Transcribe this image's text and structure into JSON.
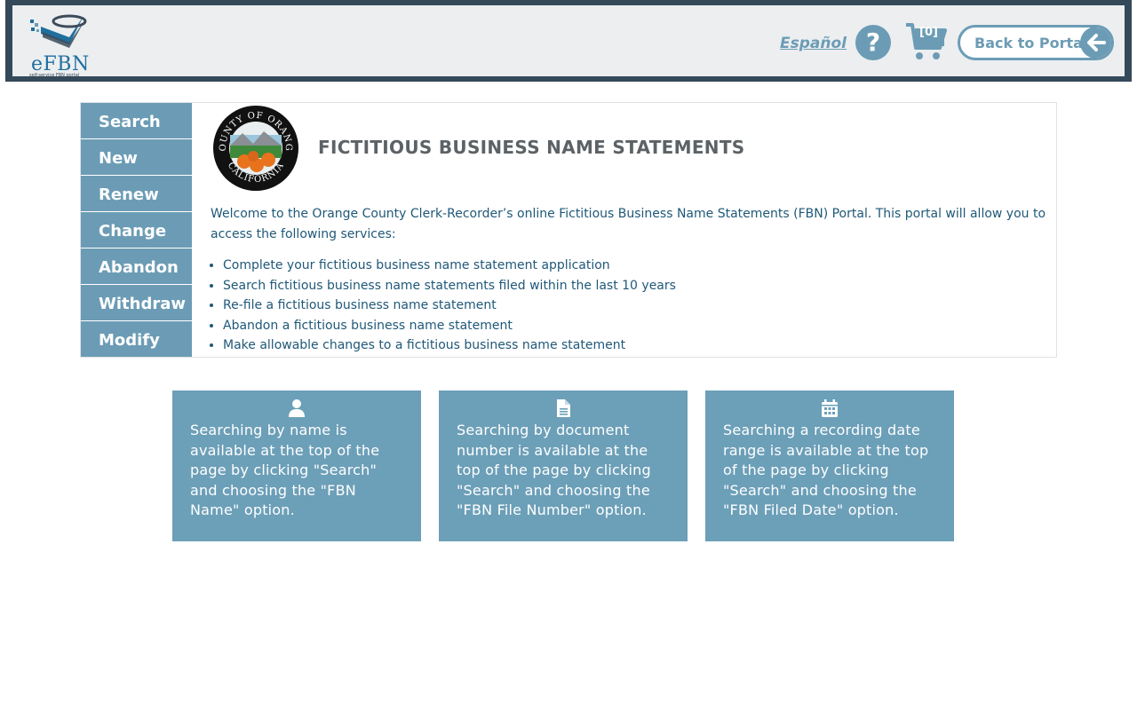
{
  "header": {
    "logo_text": "eFBN",
    "logo_subtext": "self-service FBN portal",
    "language_link": "Español",
    "help_label": "?",
    "cart_count": "[0]",
    "back_button": "Back to Portal"
  },
  "sidebar": {
    "items": [
      {
        "label": "Search"
      },
      {
        "label": "New"
      },
      {
        "label": "Renew"
      },
      {
        "label": "Change"
      },
      {
        "label": "Abandon"
      },
      {
        "label": "Withdraw"
      },
      {
        "label": "Modify"
      }
    ]
  },
  "main": {
    "seal_top_text": "COUNTY OF ORANGE",
    "seal_bottom_text": "CALIFORNIA",
    "title": "FICTITIOUS BUSINESS NAME STATEMENTS",
    "intro": "Welcome to the Orange County Clerk-Recorder’s online Fictitious Business Name Statements (FBN) Portal. This portal will allow you to access the following services:",
    "services": [
      "Complete your fictitious business name statement application",
      "Search fictitious business name statements filed within the last 10 years",
      "Re-file a fictitious business name statement",
      "Abandon a fictitious business name statement",
      "Make allowable changes to a fictitious business name statement"
    ]
  },
  "cards": [
    {
      "icon": "user-icon",
      "text": "Searching by name is available at the top of the page by clicking \"Search\" and choosing the \"FBN Name\" option."
    },
    {
      "icon": "document-icon",
      "text": "Searching by document number is available at the top of the page by clicking \"Search\" and choosing the \"FBN File Number\" option."
    },
    {
      "icon": "calendar-icon",
      "text": "Searching a recording date range is available at the top of the page by clicking \"Search\" and choosing the \"FBN Filed Date\" option."
    }
  ],
  "colors": {
    "accent": "#6c9cb5",
    "header_frame": "#34495a",
    "body_text": "#1f5878"
  }
}
